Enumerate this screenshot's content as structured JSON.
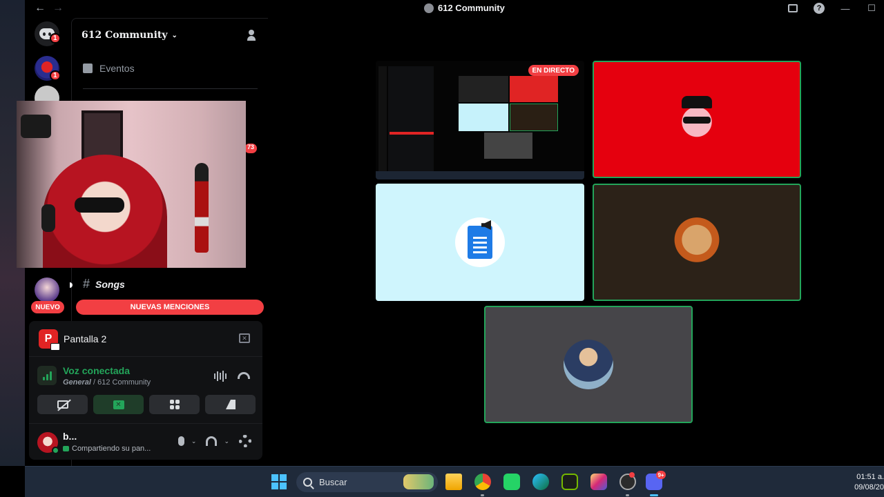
{
  "window": {
    "title": "612 Community",
    "back_arrow": "←",
    "forward_arrow": "→",
    "help_label": "?",
    "minimize_label": "—",
    "maximize_label": "☐"
  },
  "servers": {
    "badge_discord": "1",
    "badge_red": "1",
    "nuevo_label": "NUEVO"
  },
  "sidebar": {
    "guild_name": "612 Community",
    "guild_chevron": "⌄",
    "events_label": "Eventos",
    "mention_badge": "73",
    "channel_hash": "#",
    "channel_name": "Songs",
    "new_mentions_label": "NUEVAS MENCIONES"
  },
  "stream": {
    "badge_letter": "P",
    "title": "Pantalla 2"
  },
  "voice": {
    "status": "Voz conectada",
    "channel": "General",
    "server": " / 612 Community"
  },
  "user": {
    "name": "b...",
    "status": "Compartiendo su pan...",
    "caret": "⌄"
  },
  "stage": {
    "live_badge": "EN DIRECTO"
  },
  "taskbar": {
    "search_placeholder": "Buscar",
    "discord_badge": "9+",
    "time": "01:51 a.",
    "date": "09/08/20"
  }
}
